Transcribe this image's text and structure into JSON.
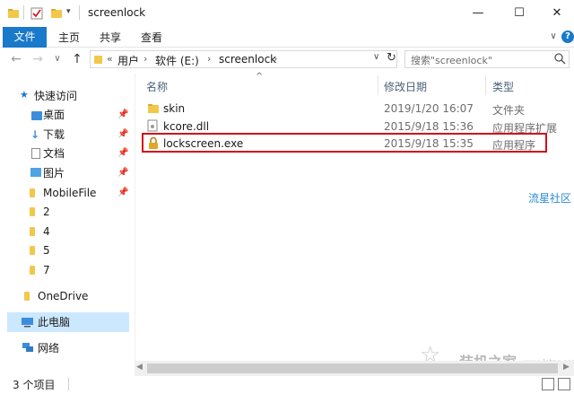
{
  "window": {
    "title": "screenlock",
    "minimize": "—",
    "maximize": "☐",
    "close": "✕"
  },
  "ribbon": {
    "file": "文件",
    "tabs": [
      "主页",
      "共享",
      "查看"
    ],
    "expand": "∨",
    "help": "?"
  },
  "nav": {
    "back": "←",
    "forward": "→",
    "recent": "∨",
    "up": "↑",
    "crumbs": [
      "用户",
      "软件 (E:)",
      "screenlock"
    ],
    "overflow": "«",
    "refresh": "↻",
    "search_placeholder": "搜索\"screenlock\""
  },
  "sidebar": {
    "quick_access": "快速访问",
    "items": [
      {
        "label": "桌面",
        "pinned": true
      },
      {
        "label": "下载",
        "pinned": true
      },
      {
        "label": "文档",
        "pinned": true
      },
      {
        "label": "图片",
        "pinned": true
      },
      {
        "label": "MobileFile",
        "pinned": true
      },
      {
        "label": "2",
        "pinned": false
      },
      {
        "label": "4",
        "pinned": false
      },
      {
        "label": "5",
        "pinned": false
      },
      {
        "label": "7",
        "pinned": false
      }
    ],
    "onedrive": "OneDrive",
    "this_pc": "此电脑",
    "network": "网络"
  },
  "table": {
    "columns": [
      "名称",
      "修改日期",
      "类型"
    ],
    "rows": [
      {
        "name": "skin",
        "date": "2019/1/20 16:07",
        "type": "文件夹",
        "icon": "folder-icon"
      },
      {
        "name": "kcore.dll",
        "date": "2015/9/18 15:36",
        "type": "应用程序扩展",
        "icon": "dll-file-icon"
      },
      {
        "name": "lockscreen.exe",
        "date": "2015/9/18 15:35",
        "type": "应用程序",
        "icon": "exe-lock-icon"
      }
    ]
  },
  "watermarks": {
    "side": "流星社区",
    "logo_text": "装机之家",
    "logo_url": "www.lotpc.com"
  },
  "status": {
    "count": "3 个项目"
  },
  "colors": {
    "accent": "#1979ca",
    "selection": "#cce8ff",
    "highlight_border": "#d0101b",
    "folder": "#f2c84b"
  }
}
